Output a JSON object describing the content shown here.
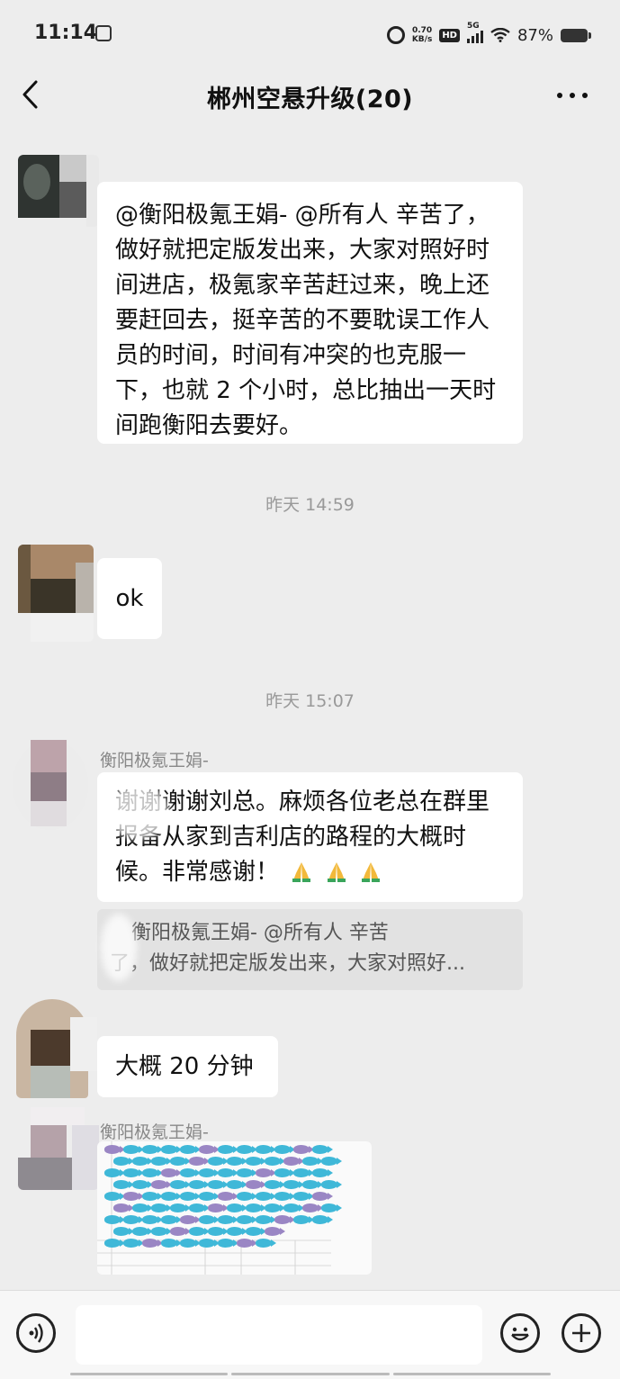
{
  "status_bar": {
    "time": "11:14",
    "net_speed_value": "0.70",
    "net_speed_unit": "KB/s",
    "hd_label": "HD",
    "network": "5G",
    "battery_text": "87%"
  },
  "header": {
    "title": "郴州空悬升级(20)"
  },
  "messages": [
    {
      "text": "@衡阳极氪王娟- @所有人  辛苦了，做好就把定版发出来，大家对照好时间进店，极氪家辛苦赶过来，晚上还要赶回去，挺辛苦的不要耽误工作人员的时间，时间有冲突的也克服一下，也就 2 个小时，总比抽出一天时间跑衡阳去要好。"
    },
    {
      "timestamp": "昨天 14:59"
    },
    {
      "text": "ok"
    },
    {
      "timestamp": "昨天 15:07"
    },
    {
      "nickname": "衡阳极氪王娟-",
      "text": "谢谢谢谢刘总。麻烦各位老总在群里报备从家到吉利店的路程的大概时候。非常感谢！",
      "emoji": "🙏🙏🙏",
      "quote_line1": "衡阳极氪王娟- @所有人 辛苦",
      "quote_line2": "了，做好就把定版发出来，大家对照好..."
    },
    {
      "text": "大概 20 分钟"
    },
    {
      "nickname": "衡阳极氪王娟-",
      "attachment": "spreadsheet-image"
    }
  ],
  "colors": {
    "background": "#ededed",
    "bubble": "#ffffff",
    "fish_blue": "#3fb8d8",
    "fish_purple": "#9a86c4"
  }
}
